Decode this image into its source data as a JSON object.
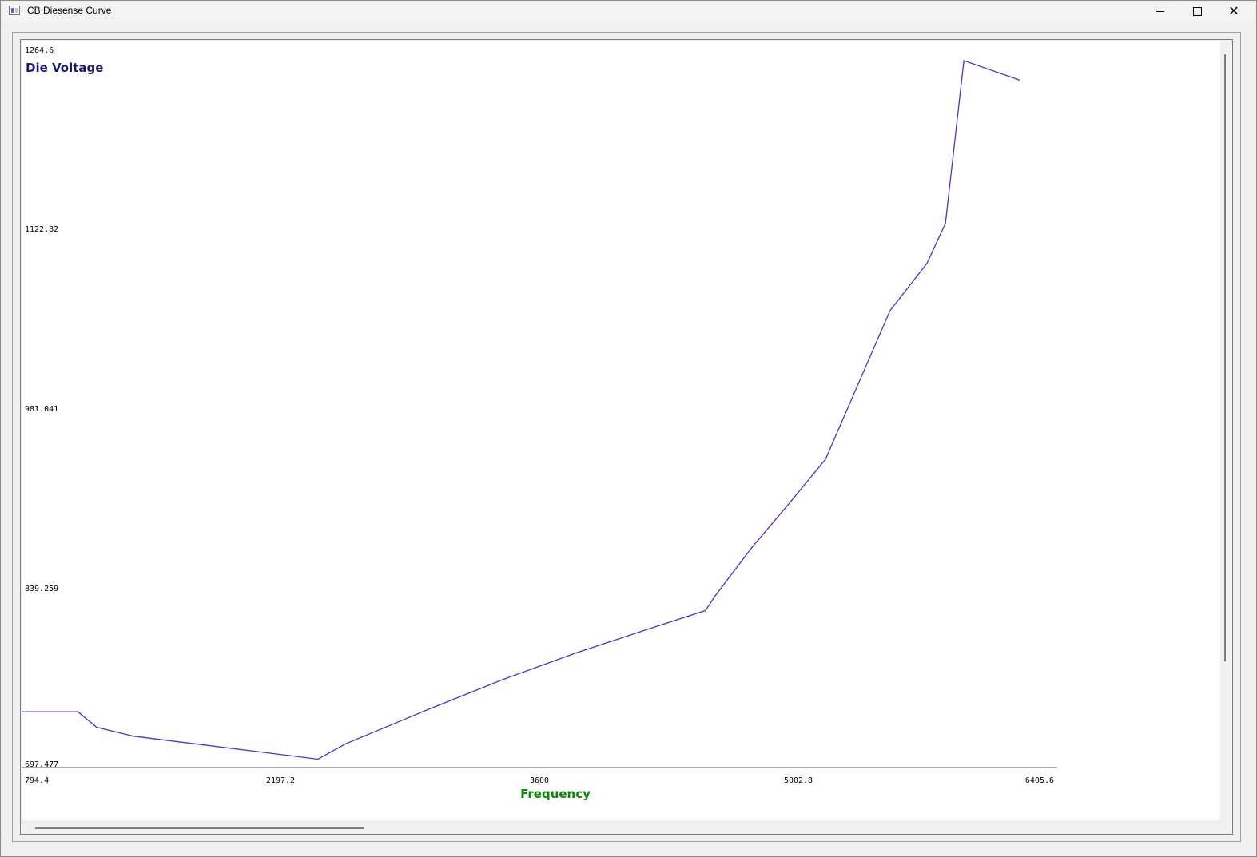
{
  "window": {
    "title": "CB Diesense Curve",
    "controls": {
      "minimize_icon": "minimize-icon",
      "maximize_icon": "maximize-icon",
      "close_icon": "close-icon"
    }
  },
  "chart_data": {
    "type": "line",
    "ylabel": "Die Voltage",
    "xlabel": "Frequency",
    "ylabel_color": "#1a1a6e",
    "xlabel_color": "#0a8a0a",
    "line_color": "#3a3acc",
    "xlim": [
      794.4,
      6405.6
    ],
    "ylim": [
      697.477,
      1264.6
    ],
    "x_ticks": [
      "794.4",
      "2197.2",
      "3600",
      "5002.8",
      "6405.6"
    ],
    "y_ticks": [
      "1264.6",
      "1122.82",
      "981.041",
      "839.259",
      "697.477"
    ],
    "grid": false,
    "series": [
      {
        "x": [
          794.4,
          1100,
          1200,
          1400,
          2400,
          2550,
          3000,
          3400,
          3800,
          4200,
          4500,
          4550,
          4750,
          4950,
          5150,
          5500,
          5700,
          5800,
          5900,
          6200
        ],
        "y": [
          741,
          741,
          729,
          722,
          704,
          716,
          743,
          766,
          787,
          806,
          820,
          831,
          869,
          903,
          938,
          1054,
          1091,
          1122,
          1249,
          1234
        ]
      }
    ]
  }
}
